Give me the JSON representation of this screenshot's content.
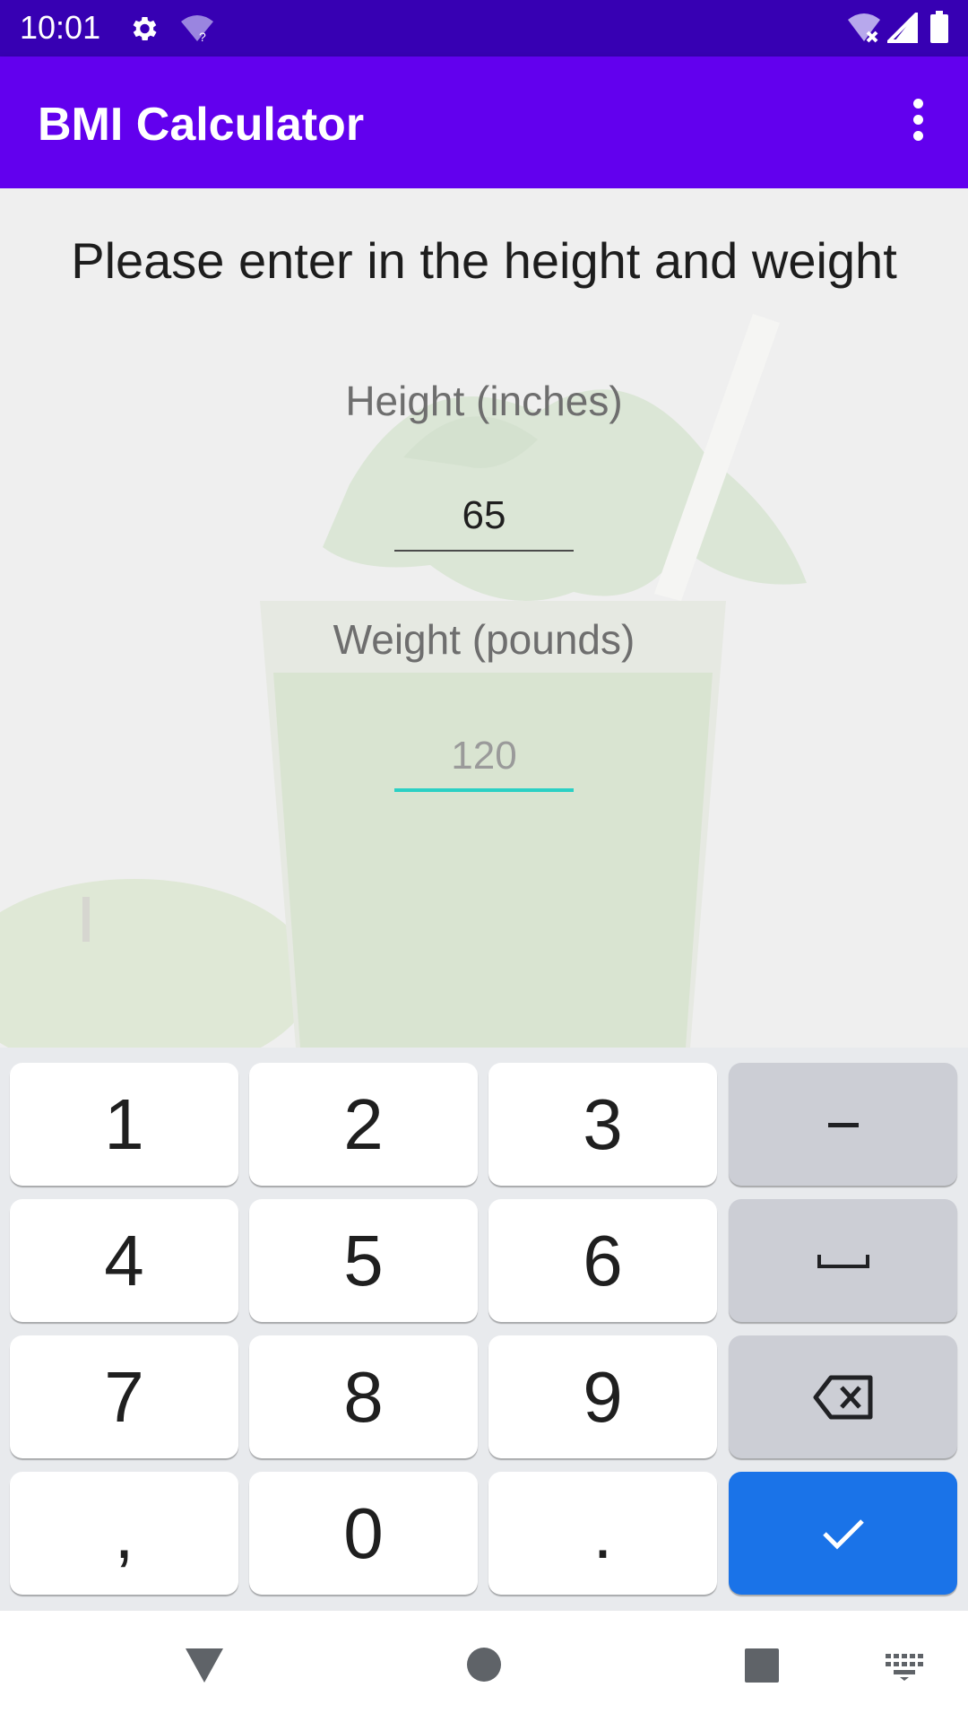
{
  "status_bar": {
    "time": "10:01",
    "icons": [
      "settings-gear-icon",
      "wifi-question-icon",
      "wifi-off-icon",
      "cellular-signal-icon",
      "battery-icon"
    ]
  },
  "app_bar": {
    "title": "BMI Calculator",
    "overflow_icon": "more-vertical-icon",
    "color": "#6200ee"
  },
  "main": {
    "prompt": "Please enter in the height and weight",
    "height_label": "Height (inches)",
    "height_value": "65",
    "weight_label": "Weight (pounds)",
    "weight_placeholder": "120",
    "focus_color": "#2bd0c4"
  },
  "keyboard": {
    "rows": [
      [
        "1",
        "2",
        "3",
        "-"
      ],
      [
        "4",
        "5",
        "6",
        "space"
      ],
      [
        "7",
        "8",
        "9",
        "backspace"
      ],
      [
        ",",
        "0",
        ".",
        "done"
      ]
    ],
    "action_color": "#1a73e8"
  },
  "nav_bar": {
    "buttons": [
      "back-triangle-icon",
      "home-circle-icon",
      "recents-square-icon",
      "keyboard-switch-icon"
    ]
  }
}
